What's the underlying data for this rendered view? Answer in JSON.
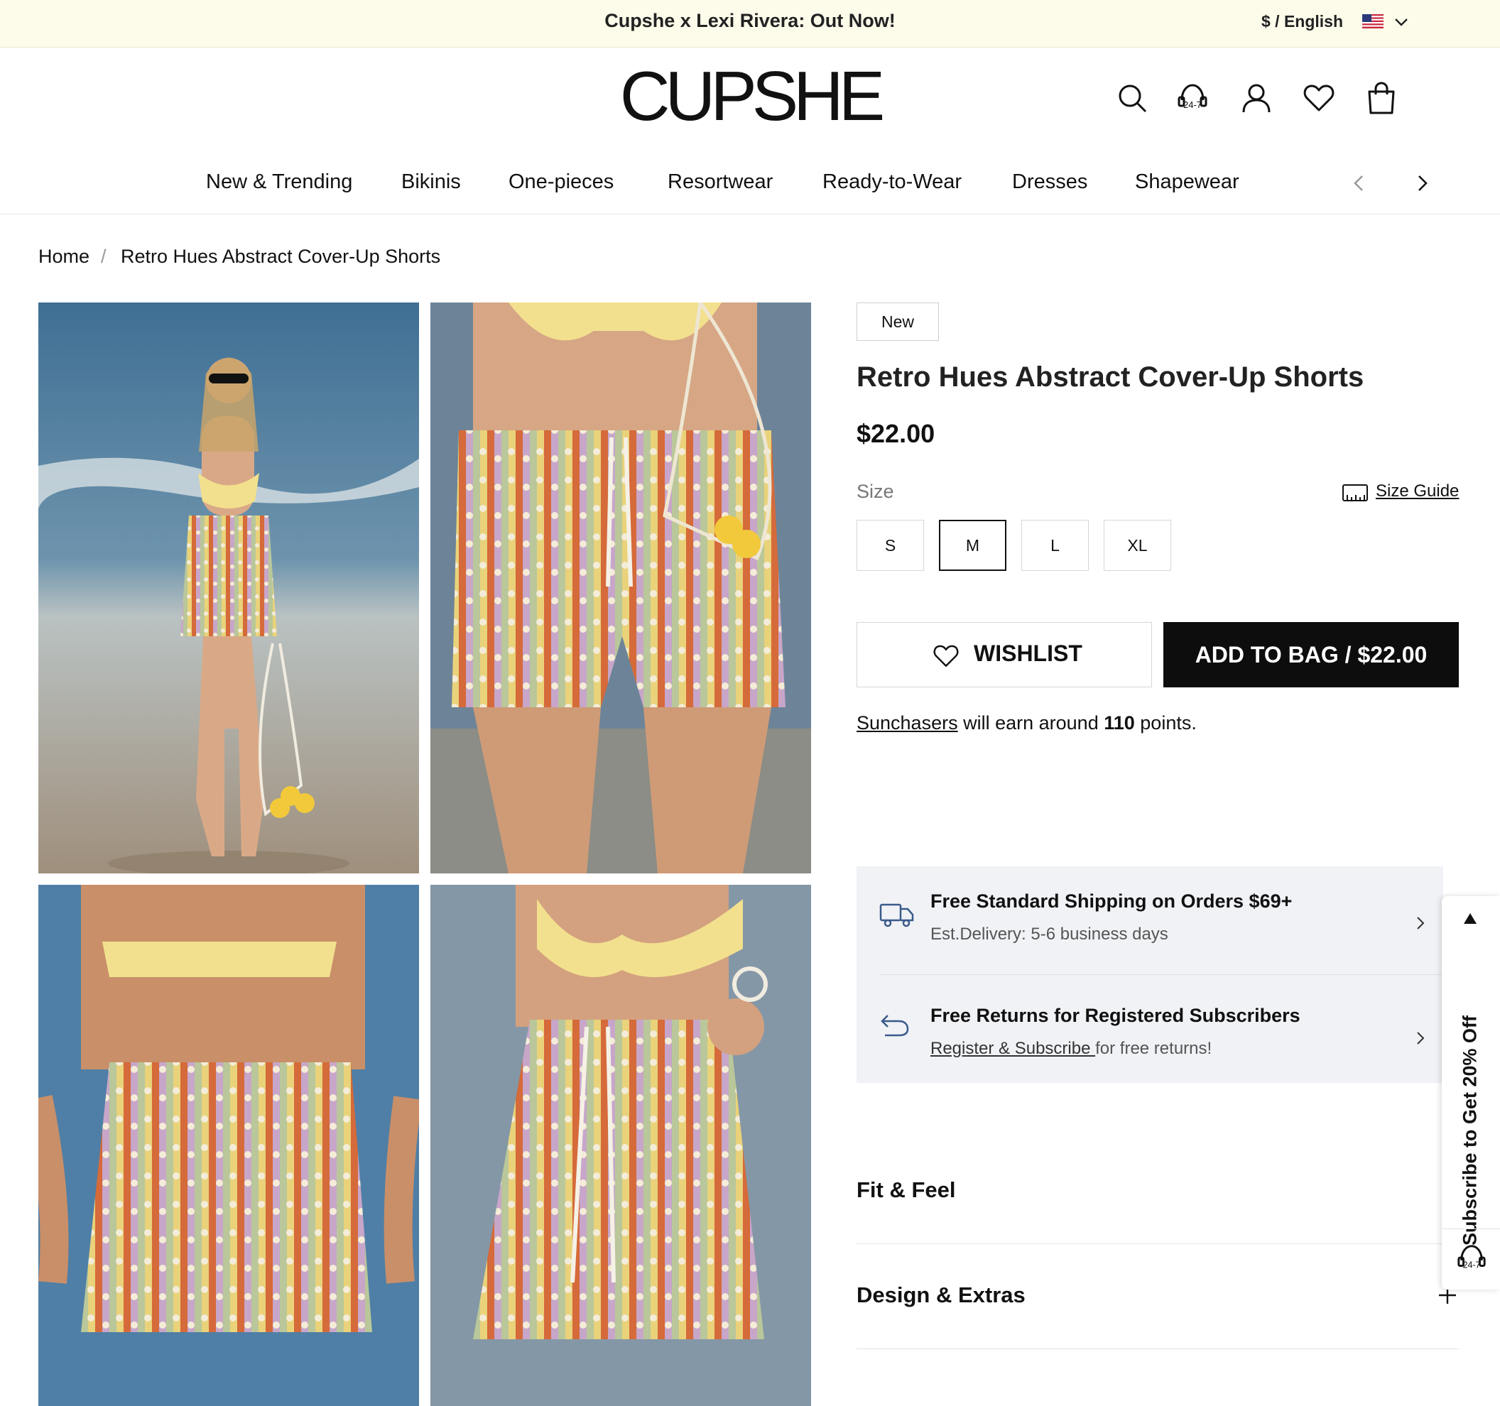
{
  "promo": {
    "text": "Cupshe x Lexi Rivera: Out Now!",
    "locale": "$ / English"
  },
  "header": {
    "logo": "CUPSHE",
    "icons": [
      "search-icon",
      "support-24-7-icon",
      "account-icon",
      "wishlist-heart-icon",
      "shopping-bag-icon"
    ]
  },
  "nav": {
    "items": [
      "New & Trending",
      "Bikinis",
      "One-pieces",
      "Resortwear",
      "Ready-to-Wear",
      "Dresses",
      "Shapewear"
    ]
  },
  "breadcrumb": {
    "home": "Home",
    "sep": "/",
    "current": "Retro Hues Abstract Cover-Up Shorts"
  },
  "product": {
    "badge": "New",
    "title": "Retro Hues Abstract Cover-Up Shorts",
    "price": "$22.00",
    "size_label": "Size",
    "size_guide": "Size Guide",
    "sizes": [
      "S",
      "M",
      "L",
      "XL"
    ],
    "selected_size": "M",
    "wishlist": "WISHLIST",
    "add_to_bag": "ADD TO BAG / $22.00",
    "points": {
      "program": "Sunchasers",
      "text1": " will earn around ",
      "amount": "110",
      "text2": " points."
    }
  },
  "shipping": {
    "title": "Free Standard Shipping on Orders $69+",
    "sub": "Est.Delivery: 5-6 business days",
    "returns_title": "Free Returns for Registered Subscribers",
    "returns_link": "Register & Subscribe ",
    "returns_sub": "for free returns!"
  },
  "accordion": [
    "Fit & Feel",
    "Design & Extras"
  ],
  "side_tab": {
    "text": "Subscribe to Get 20% Off"
  },
  "colors": {
    "promo_bg": "#fdfbea",
    "button_dark": "#0d0d0d",
    "shipping_bg": "#f1f2f6"
  }
}
